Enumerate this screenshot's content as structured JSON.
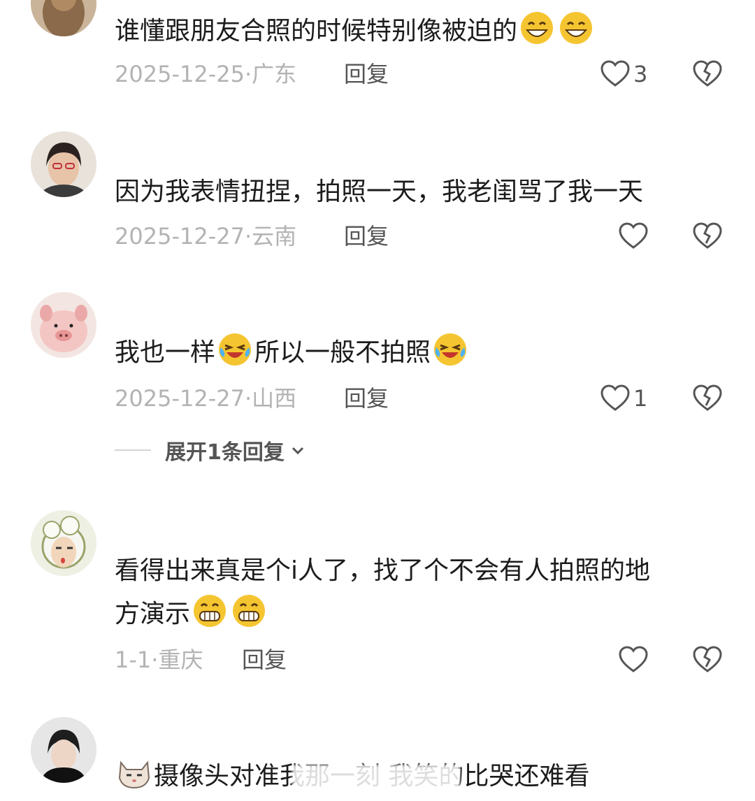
{
  "comments": [
    {
      "username": "",
      "text": "谁懂跟朋友合照的时候特别像被迫的",
      "date": "2025-12-25",
      "location": "广东",
      "reply_label": "回复",
      "likes": "3",
      "emojis": [
        "grin-emoji",
        "grin-emoji"
      ]
    },
    {
      "username": "",
      "text": "因为我表情扭捏，拍照一天，我老闺骂了我一天",
      "date": "2025-12-27",
      "location": "云南",
      "reply_label": "回复",
      "likes": ""
    },
    {
      "username": "",
      "text_part1": "我也一样",
      "text_part2": "所以一般不拍照",
      "date": "2025-12-27",
      "location": "山西",
      "reply_label": "回复",
      "likes": "1",
      "expand_label": "展开1条回复"
    },
    {
      "username": "",
      "text_line1": "看得出来真是个i人了，找了个不会有人拍照的地",
      "text_line2": "方演示",
      "date": "1-1",
      "location": "重庆",
      "reply_label": "回复",
      "likes": ""
    },
    {
      "username": "",
      "text": "摄像头对准我那一刻 我笑的比哭还难看",
      "emoji": "cat-emoji"
    }
  ],
  "colors": {
    "meta_gray": "#b3b3b3",
    "reply_gray": "#555555",
    "emoji_yellow": "#f5c531"
  }
}
